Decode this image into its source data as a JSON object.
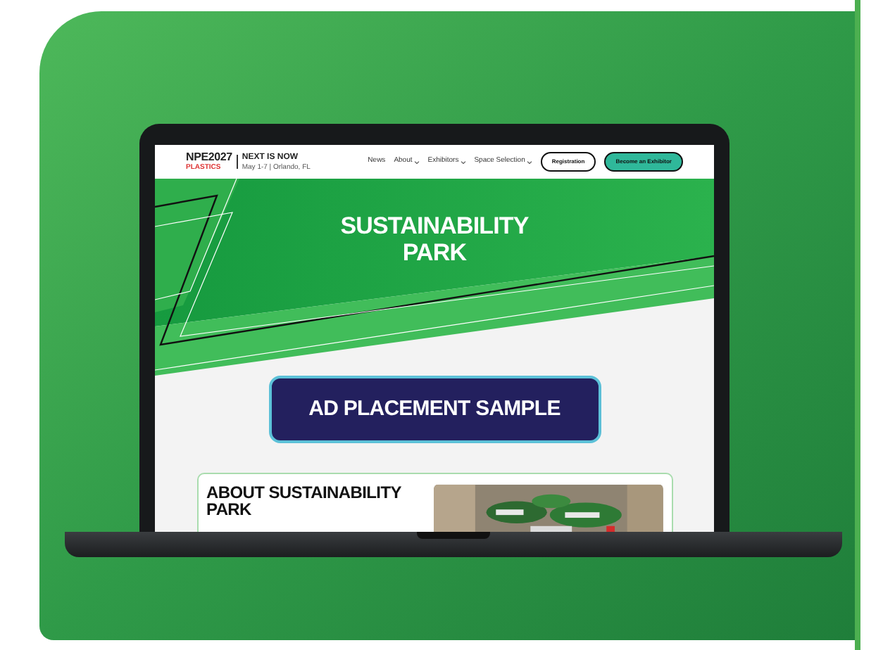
{
  "nav": {
    "logo": {
      "brand": "NPE2027",
      "tagline": "NEXT IS NOW",
      "sponsor": "PLASTICS",
      "dates": "May 1-7 | Orlando, FL"
    },
    "links": [
      {
        "label": "News",
        "dropdown": false
      },
      {
        "label": "About",
        "dropdown": true
      },
      {
        "label": "Exhibitors",
        "dropdown": true
      },
      {
        "label": "Space Selection",
        "dropdown": true
      }
    ],
    "buttons": [
      {
        "label": "Registration",
        "kind": "outline"
      },
      {
        "label": "Become an Exhibitor",
        "kind": "filled"
      }
    ]
  },
  "hero": {
    "title_lines": [
      "SUSTAINABILITY",
      "PARK"
    ]
  },
  "ad": {
    "label": "AD PLACEMENT SAMPLE"
  },
  "about": {
    "heading": "ABOUT SUSTAINABILITY PARK"
  }
}
